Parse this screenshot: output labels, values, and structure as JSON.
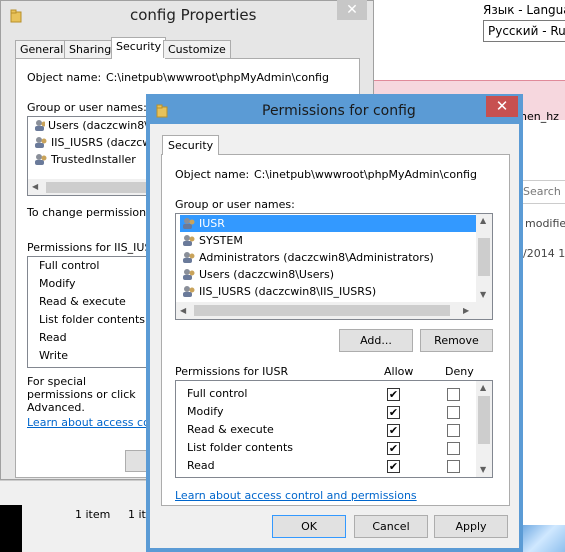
{
  "background": {
    "lang_label": "Язык - Langua",
    "lang_value": "Русский - Ru",
    "pink_text": "nen_hz",
    "search_placeholder": "Search p",
    "modified_text": "modifie",
    "date_text": "/2014 1:",
    "item1": "1 item",
    "item2": "1 it"
  },
  "config_window": {
    "title": "config Properties",
    "close": "✕",
    "tabs": [
      "General",
      "Sharing",
      "Security",
      "Customize"
    ],
    "object_name_label": "Object name:",
    "object_name_value": "C:\\inetpub\\wwwroot\\phpMyAdmin\\config",
    "group_label": "Group or user names:",
    "users": [
      "Users (daczcwin8\\U",
      "IIS_IUSRS (daczcw",
      "TrustedInstaller"
    ],
    "change_text": "To change permissions, c",
    "permissions_label": "Permissions for IIS_IUSR",
    "permissions": [
      "Full control",
      "Modify",
      "Read & execute",
      "List folder contents",
      "Read",
      "Write"
    ],
    "special_text": "For special permissions or click Advanced.",
    "link": "Learn about access contr"
  },
  "permissions_dialog": {
    "title": "Permissions for config",
    "close": "✕",
    "tab": "Security",
    "object_name_label": "Object name:",
    "object_name_value": "C:\\inetpub\\wwwroot\\phpMyAdmin\\config",
    "group_label": "Group or user names:",
    "users": [
      "IUSR",
      "SYSTEM",
      "Administrators (daczcwin8\\Administrators)",
      "Users (daczcwin8\\Users)",
      "IIS_IUSRS (daczcwin8\\IIS_IUSRS)"
    ],
    "selected_user": 0,
    "add_button": "Add...",
    "remove_button": "Remove",
    "permissions_for": "Permissions for IUSR",
    "allow_header": "Allow",
    "deny_header": "Deny",
    "permissions": [
      {
        "name": "Full control",
        "allow": true,
        "deny": false
      },
      {
        "name": "Modify",
        "allow": true,
        "deny": false
      },
      {
        "name": "Read & execute",
        "allow": true,
        "deny": false
      },
      {
        "name": "List folder contents",
        "allow": true,
        "deny": false
      },
      {
        "name": "Read",
        "allow": true,
        "deny": false
      }
    ],
    "link": "Learn about access control and permissions",
    "ok_button": "OK",
    "cancel_button": "Cancel",
    "apply_button": "Apply",
    "check_glyph": "✔"
  }
}
